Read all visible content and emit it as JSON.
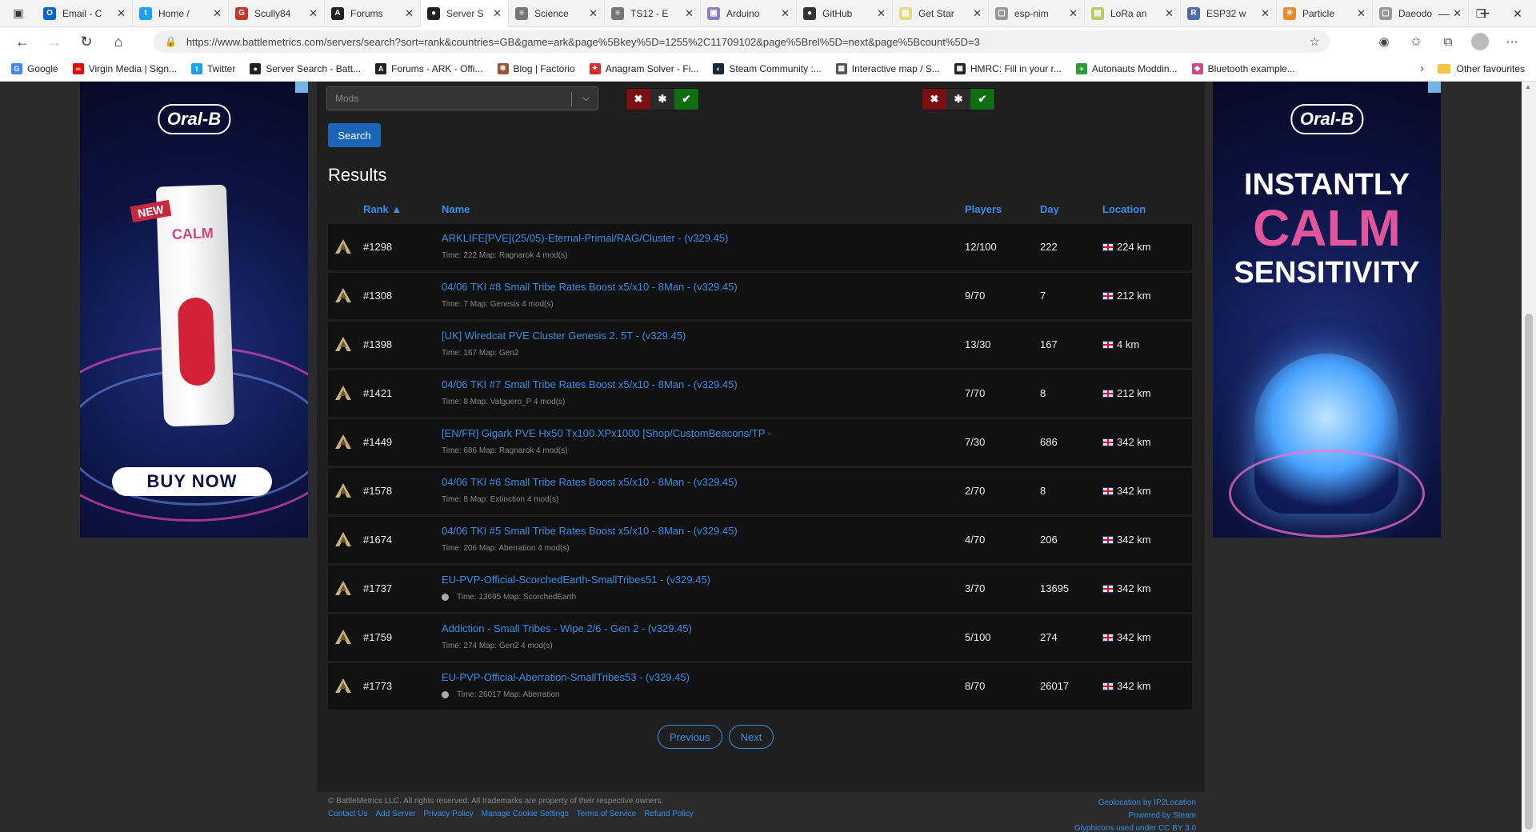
{
  "browser": {
    "tabs": [
      {
        "label": "Email - C",
        "color": "#0a64c8",
        "glyph": "O"
      },
      {
        "label": "Home /",
        "color": "#1da1f2",
        "glyph": "t"
      },
      {
        "label": "Scully84",
        "color": "#c0392b",
        "glyph": "G"
      },
      {
        "label": "Forums",
        "color": "#222222",
        "glyph": "A"
      },
      {
        "label": "Server S",
        "color": "#222222",
        "glyph": "●",
        "active": true
      },
      {
        "label": "Science",
        "color": "#777777",
        "glyph": "≡"
      },
      {
        "label": "TS12 - E",
        "color": "#777777",
        "glyph": "≡"
      },
      {
        "label": "Arduino",
        "color": "#8e7fbf",
        "glyph": "▣"
      },
      {
        "label": "GitHub",
        "color": "#333333",
        "glyph": "●"
      },
      {
        "label": "Get Star",
        "color": "#e8d98a",
        "glyph": "▤"
      },
      {
        "label": "esp-nim",
        "color": "#999999",
        "glyph": "▢"
      },
      {
        "label": "LoRa an",
        "color": "#b8c96a",
        "glyph": "▤"
      },
      {
        "label": "ESP32 w",
        "color": "#4b6ea8",
        "glyph": "R"
      },
      {
        "label": "Particle",
        "color": "#e8892b",
        "glyph": "✳"
      },
      {
        "label": "Daeodo",
        "color": "#999999",
        "glyph": "▢"
      }
    ],
    "url": "https://www.battlemetrics.com/servers/search?sort=rank&countries=GB&game=ark&page%5Bkey%5D=1255%2C11709102&page%5Brel%5D=next&page%5Bcount%5D=3",
    "bookmarks": [
      {
        "label": "Google",
        "color": "#4285f4",
        "glyph": "G"
      },
      {
        "label": "Virgin Media | Sign...",
        "color": "#e10a0a",
        "glyph": "∞"
      },
      {
        "label": "Twitter",
        "color": "#1da1f2",
        "glyph": "t"
      },
      {
        "label": "Server Search - Batt...",
        "color": "#222222",
        "glyph": "●"
      },
      {
        "label": "Forums - ARK - Offi...",
        "color": "#222222",
        "glyph": "A"
      },
      {
        "label": "Blog | Factorio",
        "color": "#a0522d",
        "glyph": "✱"
      },
      {
        "label": "Anagram Solver - Fi...",
        "color": "#d32f2f",
        "glyph": "✦"
      },
      {
        "label": "Steam Community :...",
        "color": "#1b2838",
        "glyph": "◐"
      },
      {
        "label": "Interactive map / S...",
        "color": "#555555",
        "glyph": "▦"
      },
      {
        "label": "HMRC: Fill in your r...",
        "color": "#222222",
        "glyph": "▣"
      },
      {
        "label": "Autonauts Moddin...",
        "color": "#2e9b3a",
        "glyph": "+"
      },
      {
        "label": "Bluetooth example...",
        "color": "#d04a8a",
        "glyph": "◆"
      }
    ],
    "other_favourites": "Other favourites"
  },
  "filters": {
    "mods_placeholder": "Mods",
    "search_label": "Search"
  },
  "results": {
    "title": "Results",
    "headers": {
      "rank": "Rank",
      "name": "Name",
      "players": "Players",
      "day": "Day",
      "location": "Location"
    },
    "rows": [
      {
        "rank": "#1298",
        "name": "ARKLIFE[PVE](25/05)-Eternal-Primal/RAG/Cluster - (v329.45)",
        "meta": "Time: 222  Map: Ragnarok  4 mod(s)",
        "dot": false,
        "players": "12/100",
        "day": "222",
        "location": "224 km"
      },
      {
        "rank": "#1308",
        "name": "04/06 TKI #8 Small Tribe Rates Boost x5/x10 - 8Man - (v329.45)",
        "meta": "Time: 7  Map: Genesis  4 mod(s)",
        "dot": false,
        "players": "9/70",
        "day": "7",
        "location": "212 km"
      },
      {
        "rank": "#1398",
        "name": "[UK] Wiredcat PVE Cluster Genesis 2. 5T - (v329.45)",
        "meta": "Time: 167  Map: Gen2",
        "dot": false,
        "players": "13/30",
        "day": "167",
        "location": "4 km"
      },
      {
        "rank": "#1421",
        "name": "04/06 TKI #7 Small Tribe Rates Boost x5/x10 - 8Man - (v329.45)",
        "meta": "Time: 8  Map: Valguero_P  4 mod(s)",
        "dot": false,
        "players": "7/70",
        "day": "8",
        "location": "212 km"
      },
      {
        "rank": "#1449",
        "name": "[EN/FR] Gigark PVE Hx50 Tx100 XPx1000 [Shop/CustomBeacons/TP -",
        "meta": "Time: 686  Map: Ragnarok  4 mod(s)",
        "dot": false,
        "players": "7/30",
        "day": "686",
        "location": "342 km"
      },
      {
        "rank": "#1578",
        "name": "04/06 TKI #6 Small Tribe Rates Boost x5/x10 - 8Man - (v329.45)",
        "meta": "Time: 8  Map: Extinction  4 mod(s)",
        "dot": false,
        "players": "2/70",
        "day": "8",
        "location": "342 km"
      },
      {
        "rank": "#1674",
        "name": "04/06 TKI #5 Small Tribe Rates Boost x5/x10 - 8Man - (v329.45)",
        "meta": "Time: 206  Map: Aberration  4 mod(s)",
        "dot": false,
        "players": "4/70",
        "day": "206",
        "location": "342 km"
      },
      {
        "rank": "#1737",
        "name": "EU-PVP-Official-ScorchedEarth-SmallTribes51 - (v329.45)",
        "meta": "Time: 13695  Map: ScorchedEarth",
        "dot": true,
        "players": "3/70",
        "day": "13695",
        "location": "342 km"
      },
      {
        "rank": "#1759",
        "name": "Addiction - Small Tribes - Wipe 2/6 - Gen 2 - (v329.45)",
        "meta": "Time: 274  Map: Gen2  4 mod(s)",
        "dot": false,
        "players": "5/100",
        "day": "274",
        "location": "342 km"
      },
      {
        "rank": "#1773",
        "name": "EU-PVP-Official-Aberration-SmallTribes53 - (v329.45)",
        "meta": "Time: 26017  Map: Aberration",
        "dot": true,
        "players": "8/70",
        "day": "26017",
        "location": "342 km"
      }
    ]
  },
  "pagination": {
    "previous": "Previous",
    "next": "Next"
  },
  "footer": {
    "copyright": "© BattleMetrics LLC. All rights reserved. All trademarks are property of their respective owners.",
    "links": [
      "Contact Us",
      "Add Server",
      "Privacy Policy",
      "Manage Cookie Settings",
      "Terms of Service",
      "Refund Policy"
    ],
    "credits": [
      "Geolocation by IP2Location",
      "Powered by Steam",
      "Glyphicons used under CC BY 3.0"
    ]
  },
  "ads": {
    "left": {
      "brand": "Oral-B",
      "new": "NEW",
      "product": "CALM",
      "cta": "BUY NOW"
    },
    "right": {
      "brand": "Oral-B",
      "line1": "INSTANTLY",
      "line2": "CALM",
      "line3": "SENSITIVITY"
    }
  },
  "colors": {
    "link": "#3a8ee6",
    "button": "#1a65b8",
    "row_bg": "#111111"
  }
}
